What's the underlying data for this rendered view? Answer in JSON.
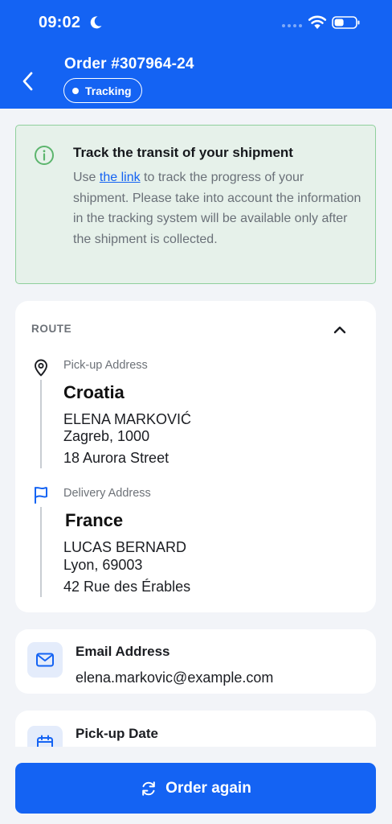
{
  "status_bar": {
    "time": "09:02"
  },
  "header": {
    "order_title": "Order #307964-24",
    "badge_label": "Tracking"
  },
  "info": {
    "title": "Track the transit of your shipment",
    "text_before_link": "Use ",
    "link_text": "the link",
    "text_after_link": " to track the progress of your shipment. Please take into account the information in the tracking system will be available only after the shipment is collected."
  },
  "route": {
    "section_label": "ROUTE",
    "pickup": {
      "label": "Pick-up Address",
      "country": "Croatia",
      "name": "ELENA MARKOVIĆ",
      "city": "Zagreb, 1000",
      "street": "18 Aurora Street"
    },
    "delivery": {
      "label": "Delivery Address",
      "country": "France",
      "name": "LUCAS BERNARD",
      "city": "Lyon, 69003",
      "street": "42 Rue des Érables"
    }
  },
  "email": {
    "label": "Email Address",
    "value": "elena.markovic@example.com"
  },
  "pickup_date": {
    "label": "Pick-up Date"
  },
  "footer": {
    "button_label": "Order again"
  },
  "colors": {
    "accent": "#1463f3",
    "info_background": "#e6f1ea",
    "info_border": "#8fcf9c",
    "info_icon": "#5cb56d"
  },
  "icons": {
    "back": "chevron-left-icon",
    "info": "info-circle-icon",
    "collapse": "chevron-up-icon",
    "pickup": "map-pin-icon",
    "delivery": "flag-icon",
    "email": "mail-icon",
    "date": "calendar-icon",
    "reorder": "refresh-icon"
  }
}
